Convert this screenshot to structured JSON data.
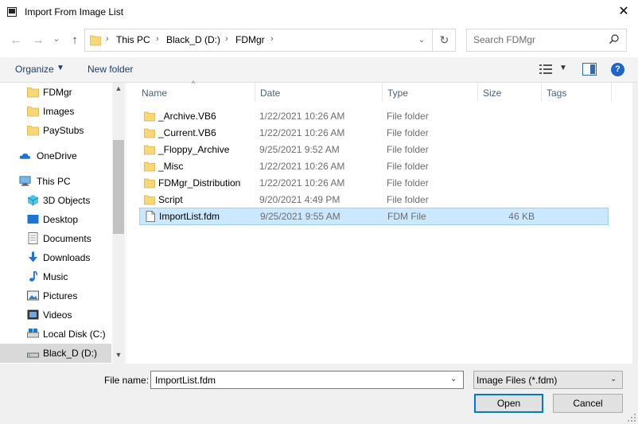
{
  "window": {
    "title": "Import From Image List",
    "close_glyph": "✕"
  },
  "nav": {
    "back_glyph": "←",
    "forward_glyph": "→",
    "recent_glyph": "⌄",
    "up_glyph": "↑",
    "breadcrumbs": [
      "This PC",
      "Black_D (D:)",
      "FDMgr"
    ],
    "chevron": "›",
    "refresh_glyph": "↻",
    "search_placeholder": "Search FDMgr"
  },
  "toolbar": {
    "organize": "Organize",
    "new_folder": "New folder",
    "help": "?"
  },
  "sidebar": {
    "items": [
      {
        "label": "FDMgr",
        "icon": "folder-icon"
      },
      {
        "label": "Images",
        "icon": "folder-icon"
      },
      {
        "label": "PayStubs",
        "icon": "folder-icon"
      },
      {
        "label": "OneDrive",
        "icon": "cloud-icon"
      },
      {
        "label": "This PC",
        "icon": "computer-icon"
      },
      {
        "label": "3D Objects",
        "icon": "cube-icon"
      },
      {
        "label": "Desktop",
        "icon": "desktop-icon"
      },
      {
        "label": "Documents",
        "icon": "documents-icon"
      },
      {
        "label": "Downloads",
        "icon": "download-icon"
      },
      {
        "label": "Music",
        "icon": "music-icon"
      },
      {
        "label": "Pictures",
        "icon": "pictures-icon"
      },
      {
        "label": "Videos",
        "icon": "videos-icon"
      },
      {
        "label": "Local Disk (C:)",
        "icon": "disk-icon"
      },
      {
        "label": "Black_D (D:)",
        "icon": "drive-icon"
      }
    ],
    "selected": "Black_D (D:)"
  },
  "filelist": {
    "columns": [
      "Name",
      "Date",
      "Type",
      "Size",
      "Tags"
    ],
    "rows": [
      {
        "name": "_Archive.VB6",
        "date": "1/22/2021 10:26 AM",
        "type": "File folder",
        "size": "",
        "kind": "folder"
      },
      {
        "name": "_Current.VB6",
        "date": "1/22/2021 10:26 AM",
        "type": "File folder",
        "size": "",
        "kind": "folder"
      },
      {
        "name": "_Floppy_Archive",
        "date": "9/25/2021 9:52 AM",
        "type": "File folder",
        "size": "",
        "kind": "folder"
      },
      {
        "name": "_Misc",
        "date": "1/22/2021 10:26 AM",
        "type": "File folder",
        "size": "",
        "kind": "folder"
      },
      {
        "name": "FDMgr_Distribution",
        "date": "1/22/2021 10:26 AM",
        "type": "File folder",
        "size": "",
        "kind": "folder"
      },
      {
        "name": "Script",
        "date": "9/20/2021 4:49 PM",
        "type": "File folder",
        "size": "",
        "kind": "folder"
      },
      {
        "name": "ImportList.fdm",
        "date": "9/25/2021 9:55 AM",
        "type": "FDM File",
        "size": "46 KB",
        "kind": "file",
        "selected": true
      }
    ]
  },
  "bottom": {
    "file_name_label": "File name:",
    "file_name_value": "ImportList.fdm",
    "filter_value": "Image Files (*.fdm)",
    "open_label": "Open",
    "cancel_label": "Cancel"
  },
  "colors": {
    "accent": "#0078d7",
    "selection": "#cce8ff",
    "folder": "#f8d775"
  }
}
